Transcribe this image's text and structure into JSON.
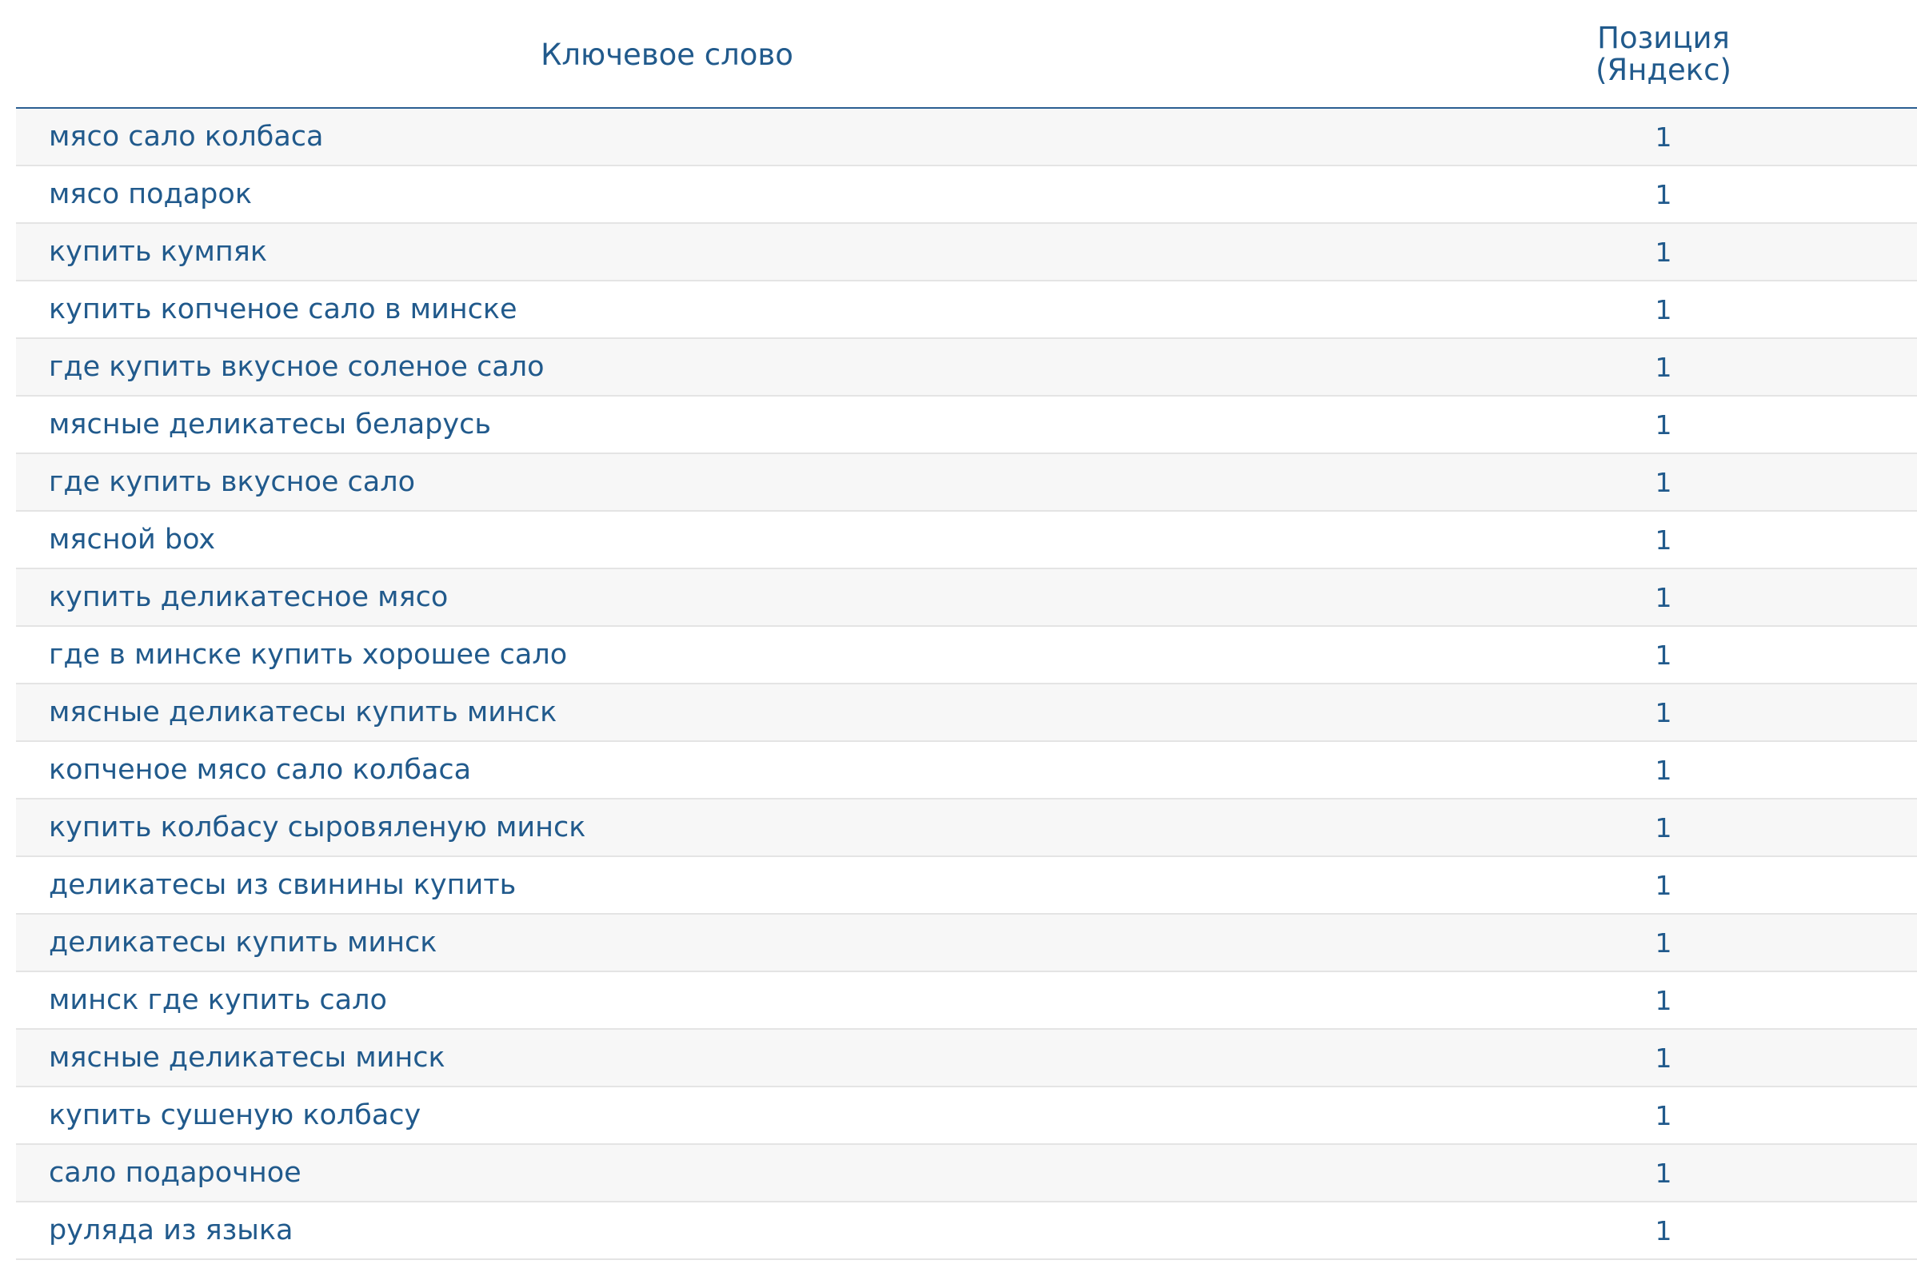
{
  "table": {
    "columns": {
      "keyword": "Ключевое слово",
      "position_line1": "Позиция",
      "position_line2": "(Яндекс)"
    },
    "rows": [
      {
        "keyword": "мясо сало колбаса",
        "position": "1"
      },
      {
        "keyword": "мясо подарок",
        "position": "1"
      },
      {
        "keyword": "купить кумпяк",
        "position": "1"
      },
      {
        "keyword": "купить копченое сало в минске",
        "position": "1"
      },
      {
        "keyword": "где купить вкусное соленое сало",
        "position": "1"
      },
      {
        "keyword": "мясные деликатесы беларусь",
        "position": "1"
      },
      {
        "keyword": "где купить вкусное сало",
        "position": "1"
      },
      {
        "keyword": "мясной box",
        "position": "1"
      },
      {
        "keyword": "купить деликатесное мясо",
        "position": "1"
      },
      {
        "keyword": "где в минске купить хорошее сало",
        "position": "1"
      },
      {
        "keyword": "мясные деликатесы купить минск",
        "position": "1"
      },
      {
        "keyword": "копченое мясо сало колбаса",
        "position": "1"
      },
      {
        "keyword": "купить колбасу сыровяленую минск",
        "position": "1"
      },
      {
        "keyword": "деликатесы из свинины купить",
        "position": "1"
      },
      {
        "keyword": "деликатесы купить минск",
        "position": "1"
      },
      {
        "keyword": "минск где купить сало",
        "position": "1"
      },
      {
        "keyword": "мясные деликатесы минск",
        "position": "1"
      },
      {
        "keyword": "купить сушеную колбасу",
        "position": "1"
      },
      {
        "keyword": "сало подарочное",
        "position": "1"
      },
      {
        "keyword": "руляда из языка",
        "position": "1"
      }
    ]
  },
  "colors": {
    "text": "#215a8c",
    "header_border": "#2b5f92",
    "row_border": "#e4e4e4",
    "row_odd": "#f7f7f7",
    "row_even": "#ffffff"
  }
}
